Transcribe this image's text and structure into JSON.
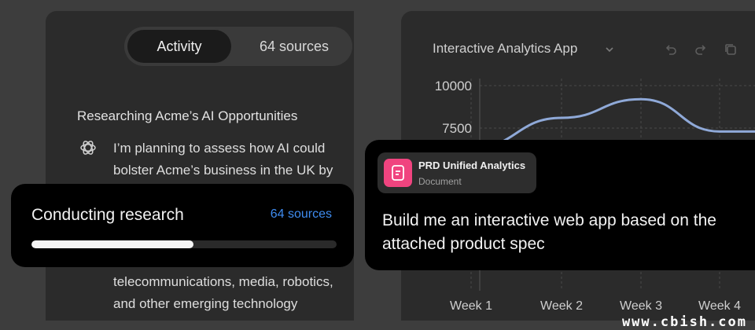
{
  "left": {
    "tabs": [
      {
        "label": "Activity",
        "active": true
      },
      {
        "label": "64 sources",
        "active": false
      }
    ],
    "research_title": "Researching Acme’s AI Opportunities",
    "thinking_icon": "openai-logo-icon",
    "body_lines": [
      "I’m planning to assess how AI could",
      "bolster Acme’s business in the UK by",
      "telecommunications, media, robotics,",
      "and other emerging technology"
    ]
  },
  "progress": {
    "title": "Conducting research",
    "sources": "64 sources",
    "fraction": 0.53,
    "accent": "#3f8cf0"
  },
  "right": {
    "app_title": "Interactive Analytics App",
    "toolbar_icons": [
      "chevron-down-icon",
      "undo-icon",
      "redo-icon",
      "copy-icon"
    ]
  },
  "chart_data": {
    "type": "line",
    "categories": [
      "Week 1",
      "Week 2",
      "Week 3",
      "Week 4"
    ],
    "yticks": [
      10000,
      7500
    ],
    "ylim": [
      0,
      10000
    ],
    "series": [
      {
        "values": [
          6300,
          8100,
          9200,
          7300
        ],
        "color": "#8fa9d8"
      }
    ],
    "grid": true
  },
  "prompt": {
    "doc_name": "PRD Unified Analytics",
    "doc_type": "Document",
    "doc_icon": "document-icon",
    "text": "Build me an interactive web app based on the attached product spec"
  },
  "watermark": "www.cbish.com"
}
